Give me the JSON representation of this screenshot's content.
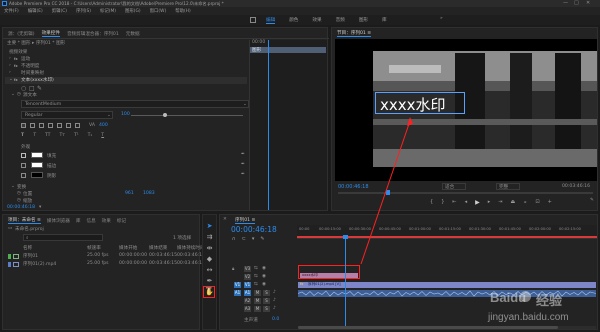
{
  "titlebar": {
    "title": "Adobe Premiere Pro CC 2018 - C:\\Users\\Administrator\\我的文档\\Adobe\\Premiere Pro\\12.0\\未命名.prproj *"
  },
  "menubar": {
    "items": [
      "文件(F)",
      "编辑(E)",
      "剪辑(C)",
      "序列(S)",
      "标记(M)",
      "图形(G)",
      "窗口(W)",
      "帮助(H)"
    ]
  },
  "workspaces": {
    "items": [
      "编辑",
      "颜色",
      "效果",
      "音频",
      "图形",
      "库"
    ]
  },
  "source_panel": {
    "tabs": [
      "源：(无剪辑)",
      "效果控件",
      "音频剪辑混合器：序列01",
      "元数据"
    ],
    "active_tab": "效果控件",
    "header": "主要 * 图形 ▸ 序列01 * 图形",
    "video_effects_label": "视频效果",
    "motion_label": "运动",
    "opacity_label": "不透明度",
    "time_remap_label": "时间重映射",
    "text_layer_label": "文本(xxxx水印)",
    "source_text_label": "源文本",
    "font_value": "TencentMedium",
    "font_style_value": "Regular",
    "font_size_value": "100",
    "tracking_value": "400",
    "appearance_label": "外观",
    "fill_label": "填充",
    "stroke_label": "描边",
    "shadow_label": "阴影",
    "transform_label": "变换",
    "position_label": "位置",
    "position_x": "961",
    "position_y": "1083",
    "scale_label": "缩放",
    "timecode": "00:00:46:18"
  },
  "mini_timeline": {
    "clip_label": "图形",
    "header": "00:00"
  },
  "program_monitor": {
    "tab": "节目：序列01 ≡",
    "overlay_text": "xxxx水印",
    "timecode": "00:00:46:18",
    "fit_label": "适合",
    "quality_label": "完整",
    "duration": "00:03:46:16",
    "colors": {
      "timecode": "#2d8ceb",
      "text_box": "#5aa0ff"
    }
  },
  "project_panel": {
    "tabs": [
      "项目：未命名 ≡",
      "媒体浏览器",
      "库",
      "信息",
      "效果",
      "标记"
    ],
    "project_file": "未命名.prproj",
    "count": "1 项选择",
    "columns": [
      "名称",
      "帧速率",
      "媒体开始",
      "媒体结束",
      "媒体持续时间"
    ],
    "rows": [
      {
        "name": "序列01",
        "fps": "25.00 fps",
        "start": "00:00:00:00",
        "end": "00:03:46:15",
        "dur": "00:03:46:16"
      },
      {
        "name": "序列01(2).mp4",
        "fps": "25.00 fps",
        "start": "00:00:00:00",
        "end": "00:03:46:15",
        "dur": "00:03:46:16"
      }
    ]
  },
  "timeline": {
    "tab": "序列01 ≡",
    "timecode": "00:00:46:18",
    "ruler": [
      "00:00",
      "00:00:15:00",
      "00:00:30:00",
      "00:00:45:00",
      "00:01:00:00",
      "00:01:15:00",
      "00:01:30:00",
      "00:01:45:00",
      "00:02:00:00",
      "00:02:15:00"
    ],
    "tracks": [
      "V3",
      "V2",
      "V1",
      "A1",
      "A2",
      "A3"
    ],
    "text_clip": "xxxx水印",
    "video_clip": "序列01(2).mp4 [V]",
    "master": "主声道",
    "master_value": "0.0",
    "colors": {
      "playhead": "#2d8ceb",
      "video": "#7d86c8",
      "audio": "#3d5f95",
      "text_clip": "#b77ea8",
      "work_area": "#d63a3a",
      "highlight": "#ff2020"
    }
  },
  "watermark": {
    "brand": "Baidu",
    "text": "经验",
    "url": "jingyan.baidu.com"
  }
}
